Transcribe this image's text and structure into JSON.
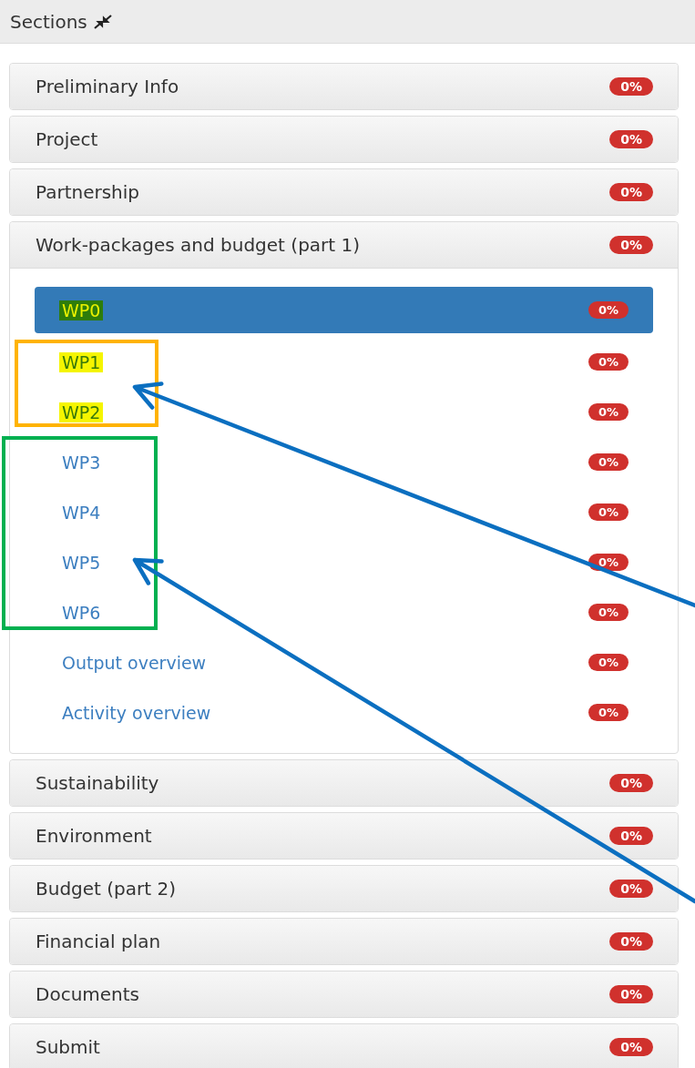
{
  "header": {
    "title": "Sections"
  },
  "sections": [
    {
      "label": "Preliminary Info",
      "badge": "0%",
      "expanded": false
    },
    {
      "label": "Project",
      "badge": "0%",
      "expanded": false
    },
    {
      "label": "Partnership",
      "badge": "0%",
      "expanded": false
    },
    {
      "label": "Work-packages and budget (part 1)",
      "badge": "0%",
      "expanded": true,
      "children": [
        {
          "label": "WP0",
          "badge": "0%",
          "selected": true,
          "color": "#2e7d0a"
        },
        {
          "label": "WP1",
          "badge": "0%",
          "selected": false,
          "color": "#f5f500"
        },
        {
          "label": "WP2",
          "badge": "0%",
          "selected": false,
          "color": "#f5f500"
        },
        {
          "label": "WP3",
          "badge": "0%",
          "selected": false
        },
        {
          "label": "WP4",
          "badge": "0%",
          "selected": false
        },
        {
          "label": "WP5",
          "badge": "0%",
          "selected": false
        },
        {
          "label": "WP6",
          "badge": "0%",
          "selected": false
        },
        {
          "label": "Output overview",
          "badge": "0%",
          "selected": false
        },
        {
          "label": "Activity overview",
          "badge": "0%",
          "selected": false
        }
      ]
    },
    {
      "label": "Sustainability",
      "badge": "0%",
      "expanded": false
    },
    {
      "label": "Environment",
      "badge": "0%",
      "expanded": false
    },
    {
      "label": "Budget (part 2)",
      "badge": "0%",
      "expanded": false
    },
    {
      "label": "Financial plan",
      "badge": "0%",
      "expanded": false
    },
    {
      "label": "Documents",
      "badge": "0%",
      "expanded": false
    },
    {
      "label": "Submit",
      "badge": "0%",
      "expanded": false
    }
  ],
  "annotations": [
    {
      "kind": "box",
      "color": "#ffb300"
    },
    {
      "kind": "box",
      "color": "#00b050"
    },
    {
      "kind": "arrow",
      "color": "#0b6fc0"
    },
    {
      "kind": "arrow",
      "color": "#0b6fc0"
    }
  ]
}
